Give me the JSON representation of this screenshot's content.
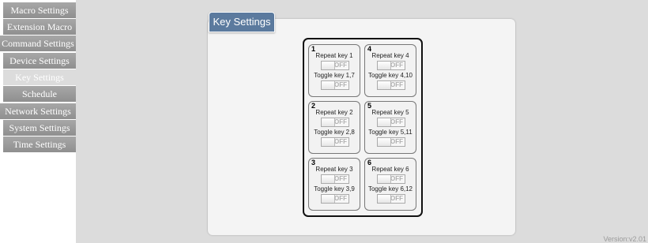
{
  "sidebar": {
    "items": [
      {
        "label": "Macro Settings",
        "active": false
      },
      {
        "label": "Extension Macro",
        "active": false
      },
      {
        "label": "Command Settings",
        "active": false
      },
      {
        "label": "Device Settings",
        "active": false
      },
      {
        "label": "Key Settings",
        "active": true
      },
      {
        "label": "Schedule",
        "active": false
      },
      {
        "label": "Network Settings",
        "active": false
      },
      {
        "label": "System Settings",
        "active": false
      },
      {
        "label": "Time Settings",
        "active": false
      }
    ]
  },
  "panel": {
    "title": "Key Settings"
  },
  "keys": [
    {
      "number": "1",
      "repeat_label": "Repeat key 1",
      "toggle_label": "Toggle key 1,7",
      "repeat_state": "OFF",
      "toggle_state": "OFF"
    },
    {
      "number": "2",
      "repeat_label": "Repeat key 2",
      "toggle_label": "Toggle key 2,8",
      "repeat_state": "OFF",
      "toggle_state": "OFF"
    },
    {
      "number": "3",
      "repeat_label": "Repeat key 3",
      "toggle_label": "Toggle key 3,9",
      "repeat_state": "OFF",
      "toggle_state": "OFF"
    },
    {
      "number": "4",
      "repeat_label": "Repeat key 4",
      "toggle_label": "Toggle key 4,10",
      "repeat_state": "OFF",
      "toggle_state": "OFF"
    },
    {
      "number": "5",
      "repeat_label": "Repeat key 5",
      "toggle_label": "Toggle key 5,11",
      "repeat_state": "OFF",
      "toggle_state": "OFF"
    },
    {
      "number": "6",
      "repeat_label": "Repeat key 6",
      "toggle_label": "Toggle key 6,12",
      "repeat_state": "OFF",
      "toggle_state": "OFF"
    }
  ],
  "footer": {
    "version": "Version:v2.01"
  },
  "colors": {
    "nav": "#9a9a9a",
    "title_tab": "#5b7a9e",
    "background": "#dcdcdc"
  }
}
